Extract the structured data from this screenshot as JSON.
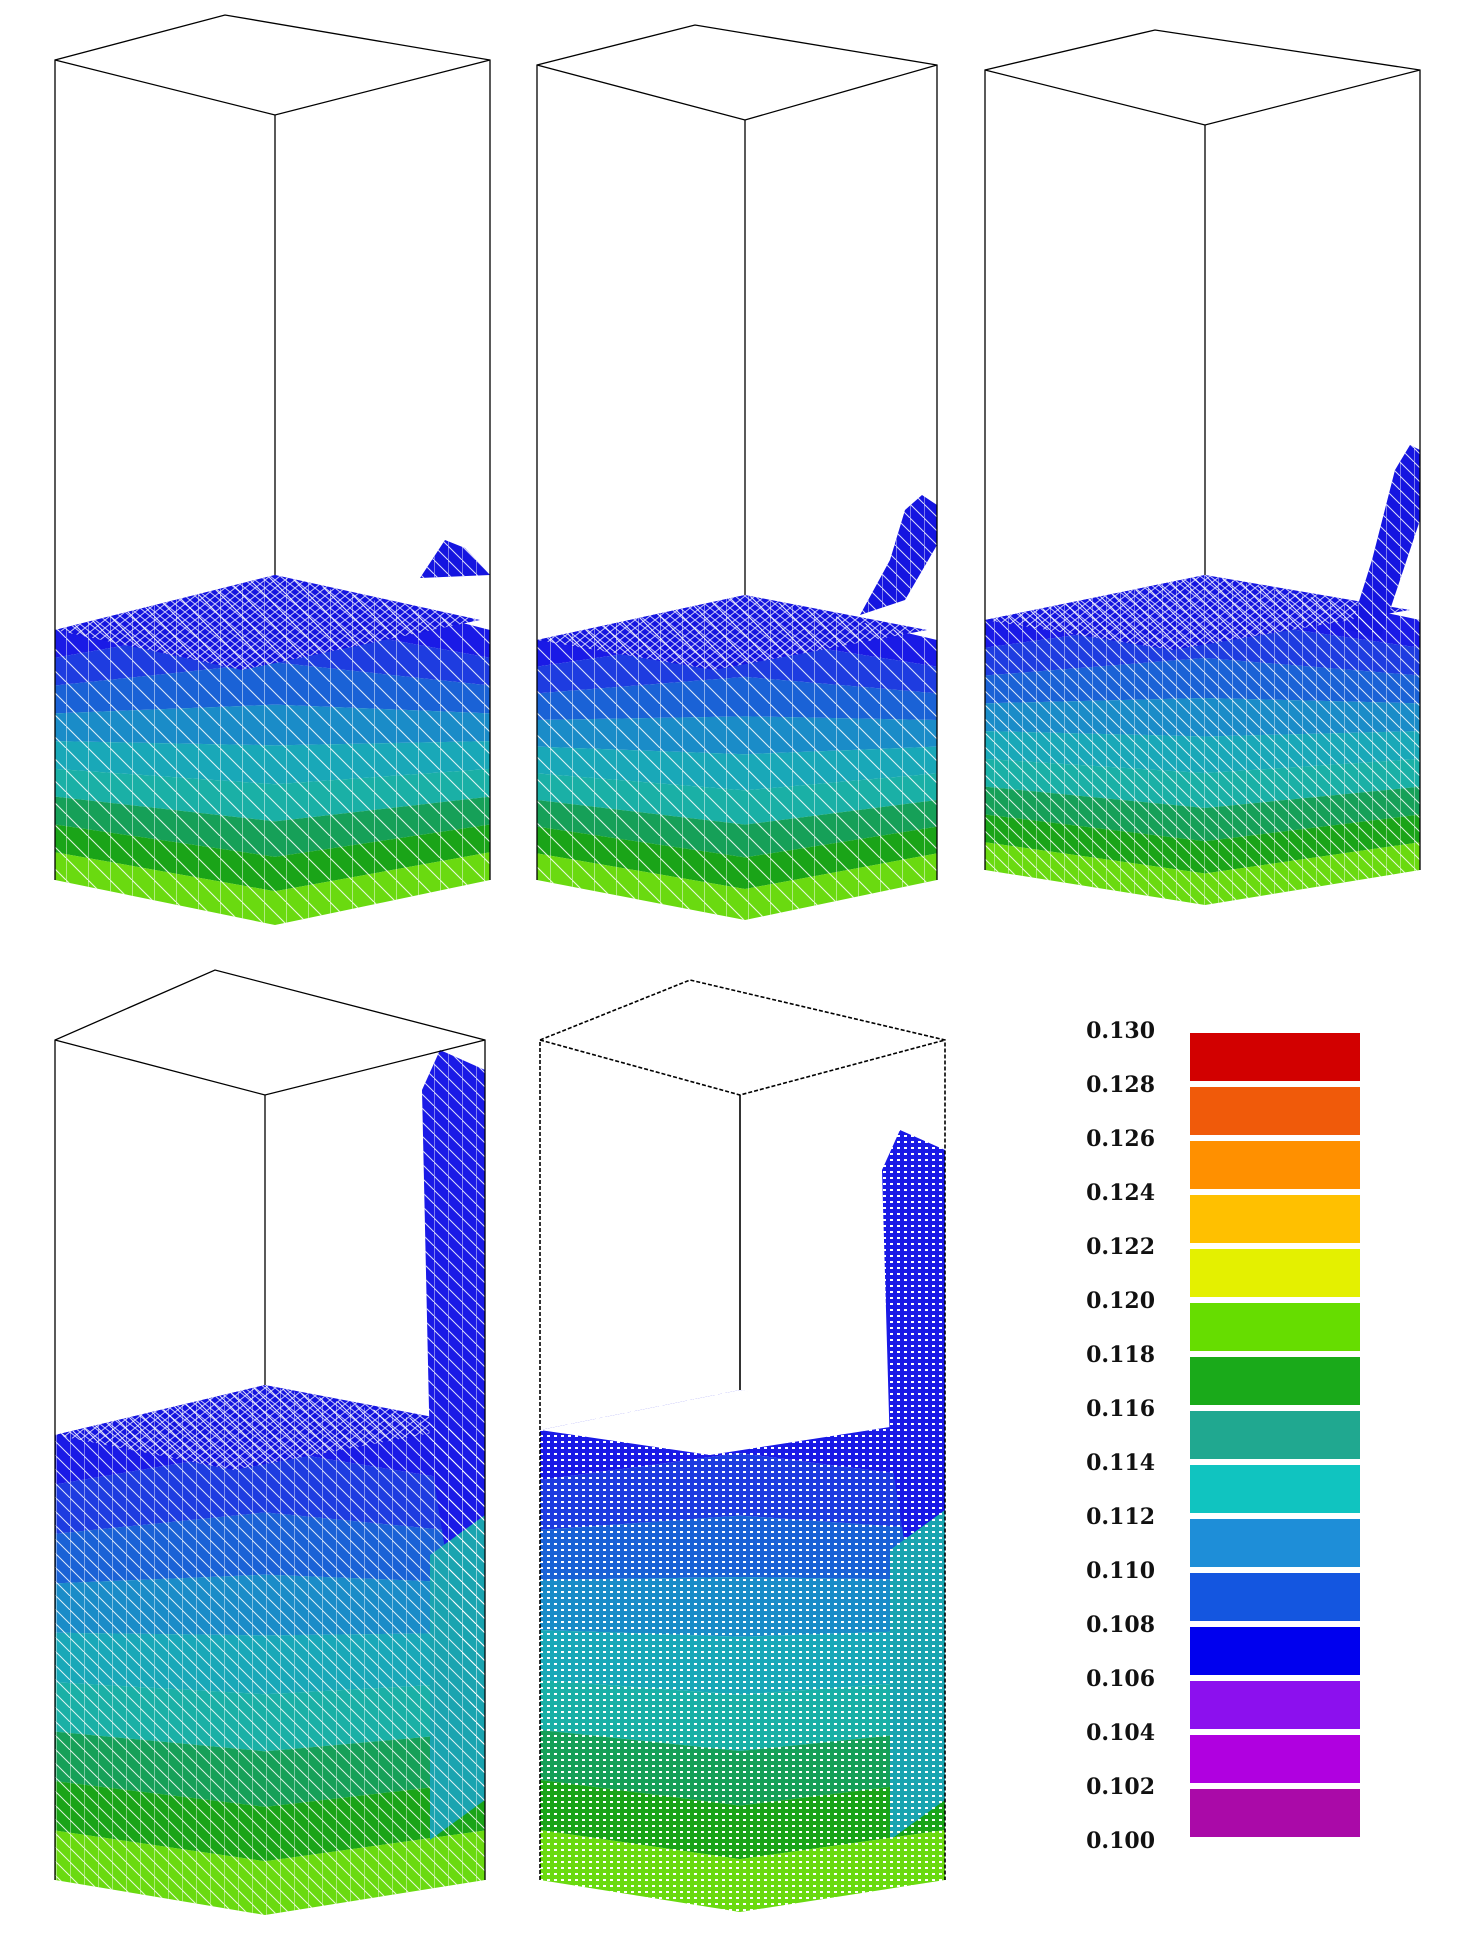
{
  "figure": {
    "panels": [
      {
        "id": "panel-1"
      },
      {
        "id": "panel-2"
      },
      {
        "id": "panel-3"
      },
      {
        "id": "panel-4"
      },
      {
        "id": "panel-5"
      }
    ]
  },
  "legend": {
    "entries": [
      {
        "label": "0.130",
        "color": "#d20000"
      },
      {
        "label": "0.128",
        "color": "#f05a0a"
      },
      {
        "label": "0.126",
        "color": "#ff9000"
      },
      {
        "label": "0.124",
        "color": "#ffc000"
      },
      {
        "label": "0.122",
        "color": "#e4f000"
      },
      {
        "label": "0.120",
        "color": "#66dd00"
      },
      {
        "label": "0.118",
        "color": "#1aaa1a"
      },
      {
        "label": "0.116",
        "color": "#20a890"
      },
      {
        "label": "0.114",
        "color": "#10c4c0"
      },
      {
        "label": "0.112",
        "color": "#1e8ed8"
      },
      {
        "label": "0.110",
        "color": "#1456e0"
      },
      {
        "label": "0.108",
        "color": "#0000ee"
      },
      {
        "label": "0.106",
        "color": "#8c10ee"
      },
      {
        "label": "0.104",
        "color": "#b000e0"
      },
      {
        "label": "0.102",
        "color": "#aa0aa8"
      }
    ],
    "last_label": "0.100"
  }
}
